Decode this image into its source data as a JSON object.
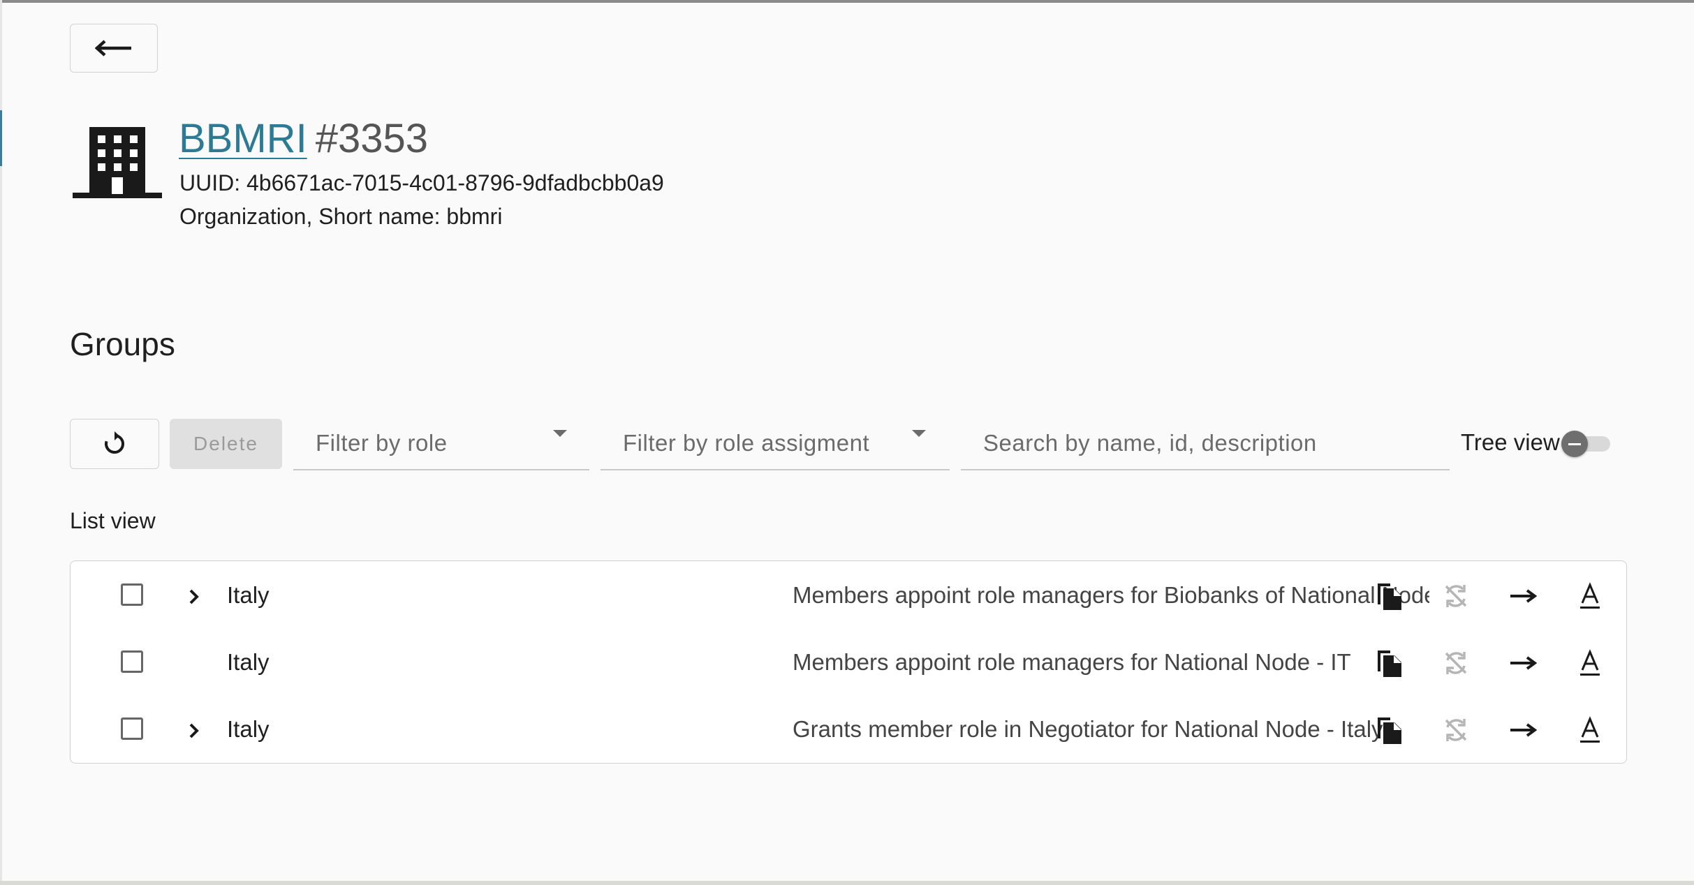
{
  "header": {
    "back_label": "←",
    "org_link": "BBMRI",
    "org_id": "#3353",
    "uuid_line": "UUID: 4b6671ac-7015-4c01-8796-9dfadbcbb0a9",
    "kind_line": "Organization, Short name: bbmri"
  },
  "groups": {
    "heading": "Groups",
    "toolbar": {
      "delete_label": "Delete",
      "filter_role_placeholder": "Filter by role",
      "filter_assignment_placeholder": "Filter by role assigment",
      "search_placeholder": "Search by name, id, description",
      "tree_view_label": "Tree view",
      "tree_view_on": false
    },
    "list_label": "List view",
    "rows": [
      {
        "name": "Italy",
        "description": "Members appoint role managers for Biobanks of National Node - IT",
        "expandable": true
      },
      {
        "name": "Italy",
        "description": "Members appoint role managers for National Node - IT",
        "expandable": false
      },
      {
        "name": "Italy",
        "description": "Grants member role in Negotiator for National Node - Italy",
        "expandable": true
      }
    ]
  },
  "icons": [
    "arrow-left-icon",
    "building-icon",
    "refresh-icon",
    "dropdown-caret-icon",
    "chevron-right-icon",
    "copy-icon",
    "sync-disabled-icon",
    "arrow-right-icon",
    "text-format-icon"
  ],
  "colors": {
    "accent": "#2d7a95",
    "background": "#fafafa",
    "disabled_button": "#e0e0e0"
  }
}
